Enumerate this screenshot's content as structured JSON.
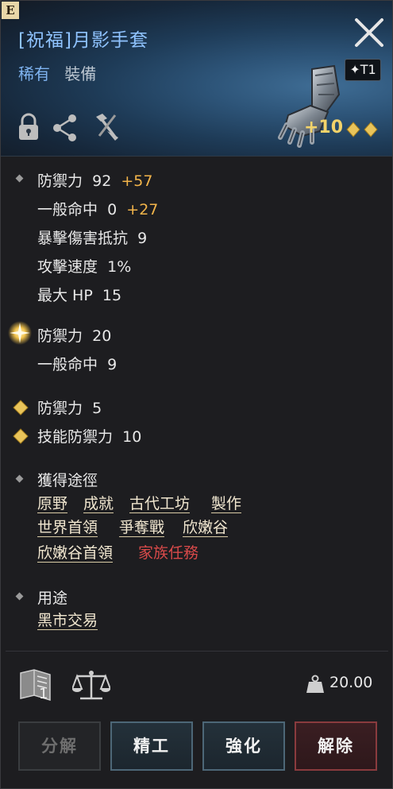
{
  "header": {
    "badge": "E",
    "title": "[祝福]月影手套",
    "rarity": "稀有",
    "category": "裝備",
    "tier": "✦T1",
    "enhancement": "+10",
    "icons": [
      "lock-icon",
      "share-icon",
      "hammer-tools-icon",
      "close-icon",
      "gauntlet-icon"
    ]
  },
  "base_stats": [
    {
      "label": "防禦力",
      "value": "92",
      "bonus": "+57"
    },
    {
      "label": "一般命中",
      "value": "0",
      "bonus": "+27"
    },
    {
      "label": "暴擊傷害抵抗",
      "value": "9",
      "bonus": ""
    },
    {
      "label": "攻擊速度",
      "value": "1%",
      "bonus": ""
    },
    {
      "label": "最大 HP",
      "value": "15",
      "bonus": ""
    }
  ],
  "blessing_stats": [
    {
      "label": "防禦力",
      "value": "20"
    },
    {
      "label": "一般命中",
      "value": "9"
    }
  ],
  "gem_stats": [
    {
      "label": "防禦力",
      "value": "5"
    },
    {
      "label": "技能防禦力",
      "value": "10"
    }
  ],
  "acquire": {
    "heading": "獲得途徑",
    "links": [
      [
        "原野",
        "成就",
        "古代工坊",
        "製作"
      ],
      [
        "世界首領",
        "爭奪戰",
        "欣嫩谷"
      ],
      [
        "欣嫩谷首領",
        "家族任務"
      ]
    ]
  },
  "usage": {
    "heading": "用途",
    "links": [
      "黑市交易"
    ]
  },
  "footer": {
    "book_count": "1",
    "weight": "20.00",
    "buttons": [
      "分解",
      "精工",
      "強化",
      "解除"
    ]
  },
  "colors": {
    "title": "#8fc3ff",
    "bonus": "#f2b44a",
    "guild_quest": "#d94a4a",
    "gold": "#e9c45a"
  }
}
